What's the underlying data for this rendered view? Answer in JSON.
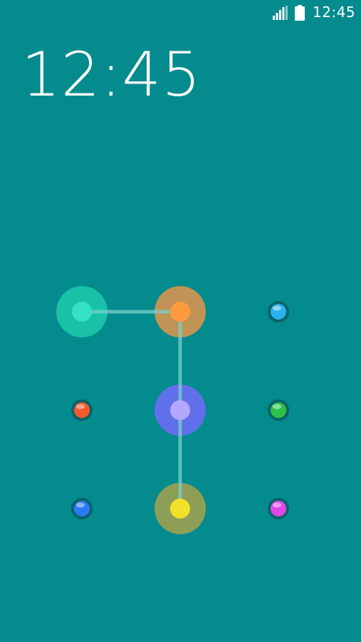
{
  "status_bar": {
    "time": "12:45",
    "signal_icon": "signal-icon",
    "battery_icon": "battery-icon"
  },
  "lock_screen": {
    "clock": "12:45"
  },
  "pattern": {
    "dots": [
      {
        "id": "dot-1",
        "color": "#35e3c4",
        "active": true
      },
      {
        "id": "dot-2",
        "color": "#ff9a3e",
        "active": true
      },
      {
        "id": "dot-3",
        "color": "#2ab2f0",
        "active": false
      },
      {
        "id": "dot-4",
        "color": "#f25a2e",
        "active": false
      },
      {
        "id": "dot-5",
        "color": "#b3a8ff",
        "active": true
      },
      {
        "id": "dot-6",
        "color": "#2ec24a",
        "active": false
      },
      {
        "id": "dot-7",
        "color": "#2a7bf2",
        "active": false
      },
      {
        "id": "dot-8",
        "color": "#f2e02a",
        "active": true
      },
      {
        "id": "dot-9",
        "color": "#e046e6",
        "active": false
      }
    ],
    "active_halo_colors": {
      "dot-1": "#1cc6a8",
      "dot-2": "#d69550",
      "dot-5": "#6a6cf4",
      "dot-8": "#9fa051"
    },
    "connection_order": [
      "dot-1",
      "dot-2",
      "dot-5",
      "dot-8"
    ],
    "line_color": "#7bd0cc"
  }
}
